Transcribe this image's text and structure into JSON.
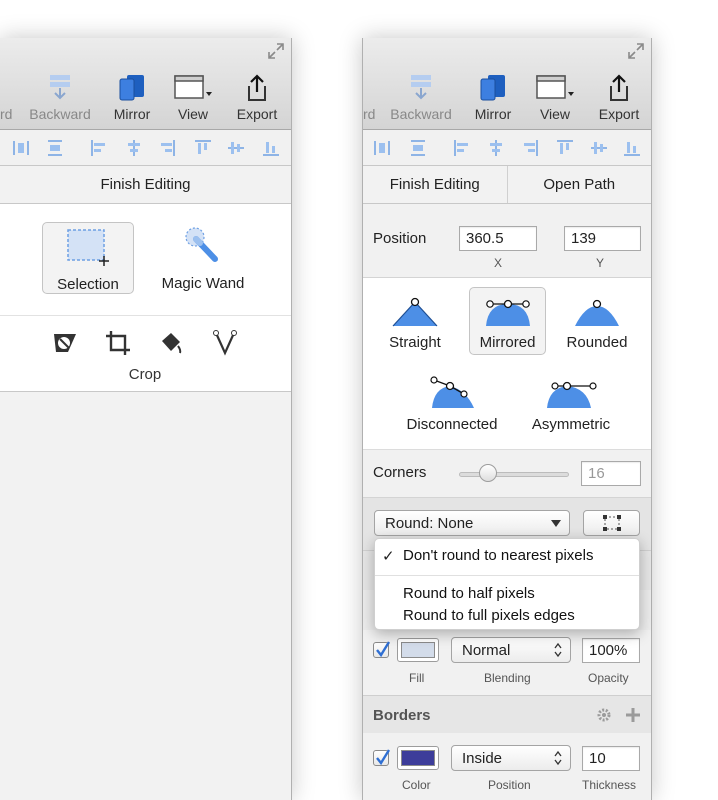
{
  "left_panel": {
    "toolbar": {
      "cut_label": "rd",
      "backward_label": "Backward",
      "mirror_label": "Mirror",
      "view_label": "View",
      "export_label": "Export"
    },
    "finish_label": "Finish Editing",
    "tools": {
      "selection_label": "Selection",
      "magic_wand_label": "Magic Wand",
      "crop_label": "Crop"
    }
  },
  "right_panel": {
    "toolbar": {
      "cut_label": "rd",
      "backward_label": "Backward",
      "mirror_label": "Mirror",
      "view_label": "View",
      "export_label": "Export"
    },
    "finish_label": "Finish Editing",
    "open_path_label": "Open Path",
    "position": {
      "label": "Position",
      "x_value": "360.5",
      "y_value": "139",
      "x_caption": "X",
      "y_caption": "Y"
    },
    "point_types": {
      "straight": "Straight",
      "mirrored": "Mirrored",
      "rounded": "Rounded",
      "disconnected": "Disconnected",
      "asymmetric": "Asymmetric"
    },
    "corners": {
      "label": "Corners",
      "value": "16",
      "slider_fraction": 0.22
    },
    "round": {
      "selected": "Round: None",
      "menu": {
        "item1": "Don't round to nearest pixels",
        "item2": "Round to half pixels",
        "item3": "Round to full pixels edges",
        "check_mark": "✓"
      }
    },
    "fill": {
      "blending": "Normal",
      "opacity": "100%",
      "fill_caption": "Fill",
      "blending_caption": "Blending",
      "opacity_caption": "Opacity",
      "swatch_color": "#d3dcea"
    },
    "borders": {
      "title": "Borders",
      "position": "Inside",
      "thickness": "10",
      "color_caption": "Color",
      "position_caption": "Position",
      "thickness_caption": "Thickness",
      "swatch_color": "#3d3d9a"
    }
  },
  "colors": {
    "icon_blue": "#4d8fe6",
    "icon_blue_light": "#9cc0ef",
    "accent_blue": "#2f6fd3"
  }
}
